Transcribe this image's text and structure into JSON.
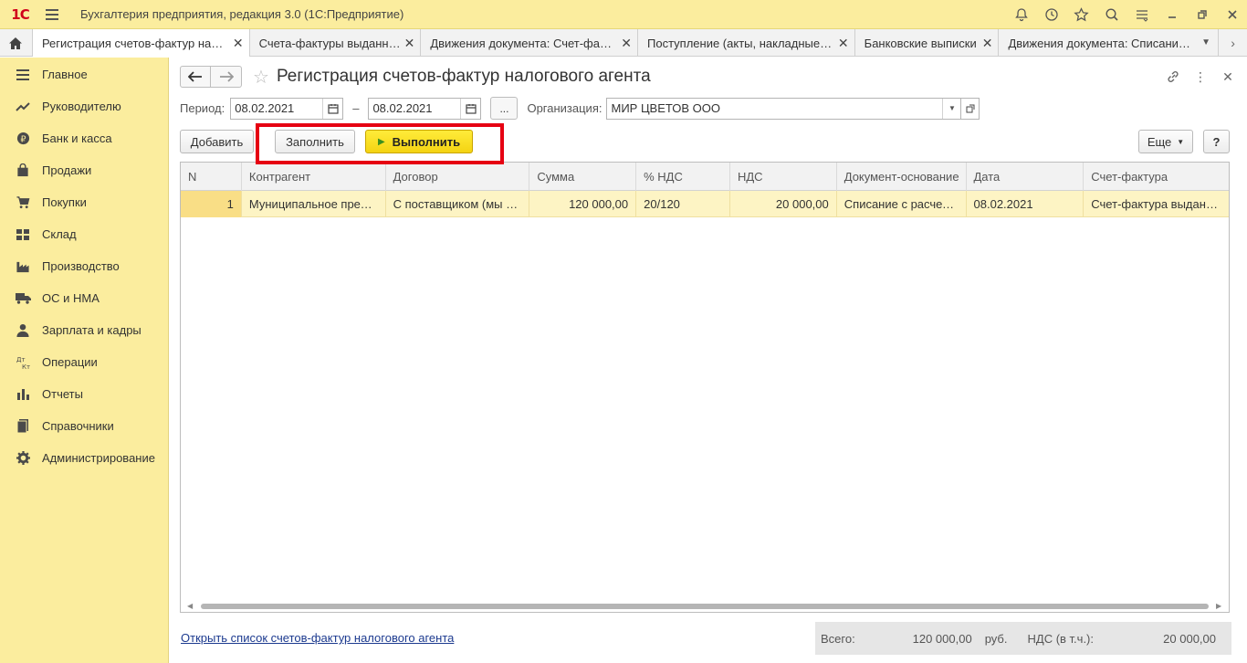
{
  "app": {
    "title": "Бухгалтерия предприятия, редакция 3.0  (1С:Предприятие)",
    "logo": "1С"
  },
  "tabs": [
    {
      "label": "Регистрация счетов-фактур налоговых агентов",
      "active": true
    },
    {
      "label": "Счета-фактуры выданные",
      "active": false
    },
    {
      "label": "Движения документа: Счет-фактура выданный",
      "active": false
    },
    {
      "label": "Поступление (акты, накладные, УПД)",
      "active": false
    },
    {
      "label": "Банковские выписки",
      "active": false
    },
    {
      "label": "Движения документа: Списание с расчетного счета",
      "active": false
    }
  ],
  "sidebar": {
    "items": [
      {
        "label": "Главное",
        "icon": "list-icon"
      },
      {
        "label": "Руководителю",
        "icon": "trend-icon"
      },
      {
        "label": "Банк и касса",
        "icon": "coin-icon"
      },
      {
        "label": "Продажи",
        "icon": "bag-icon"
      },
      {
        "label": "Покупки",
        "icon": "cart-icon"
      },
      {
        "label": "Склад",
        "icon": "warehouse-icon"
      },
      {
        "label": "Производство",
        "icon": "factory-icon"
      },
      {
        "label": "ОС и НМА",
        "icon": "truck-icon"
      },
      {
        "label": "Зарплата и кадры",
        "icon": "person-icon"
      },
      {
        "label": "Операции",
        "icon": "dt-kt-icon"
      },
      {
        "label": "Отчеты",
        "icon": "bar-chart-icon"
      },
      {
        "label": "Справочники",
        "icon": "books-icon"
      },
      {
        "label": "Администрирование",
        "icon": "gear-icon"
      }
    ]
  },
  "page": {
    "title": "Регистрация счетов-фактур налогового агента"
  },
  "filter": {
    "period_label": "Период:",
    "date_from": "08.02.2021",
    "dash": "–",
    "date_to": "08.02.2021",
    "dots": "...",
    "org_label": "Организация:",
    "org_value": "МИР ЦВЕТОВ ООО"
  },
  "toolbar": {
    "add": "Добавить",
    "fill": "Заполнить",
    "execute": "Выполнить",
    "more": "Еще",
    "help": "?"
  },
  "table": {
    "columns": [
      "N",
      "Контрагент",
      "Договор",
      "Сумма",
      "% НДС",
      "НДС",
      "Документ-основание",
      "Дата",
      "Счет-фактура"
    ],
    "rows": [
      [
        "1",
        "Муниципальное предприятие",
        "С поставщиком (мы покупатель)",
        "120 000,00",
        "20/120",
        "20 000,00",
        "Списание с расчетного счета",
        "08.02.2021",
        "Счет-фактура выданный"
      ]
    ]
  },
  "footer": {
    "link": "Открыть список счетов-фактур налогового агента",
    "total_label": "Всего:",
    "total_value": "120 000,00",
    "currency": "руб.",
    "vat_label": "НДС (в т.ч.):",
    "vat_value": "20 000,00"
  },
  "colors": {
    "accent_yellow": "#fbed9e",
    "execute_button": "#f4d312",
    "highlight_box": "#e60012",
    "selected_row": "#fdf4c4"
  }
}
